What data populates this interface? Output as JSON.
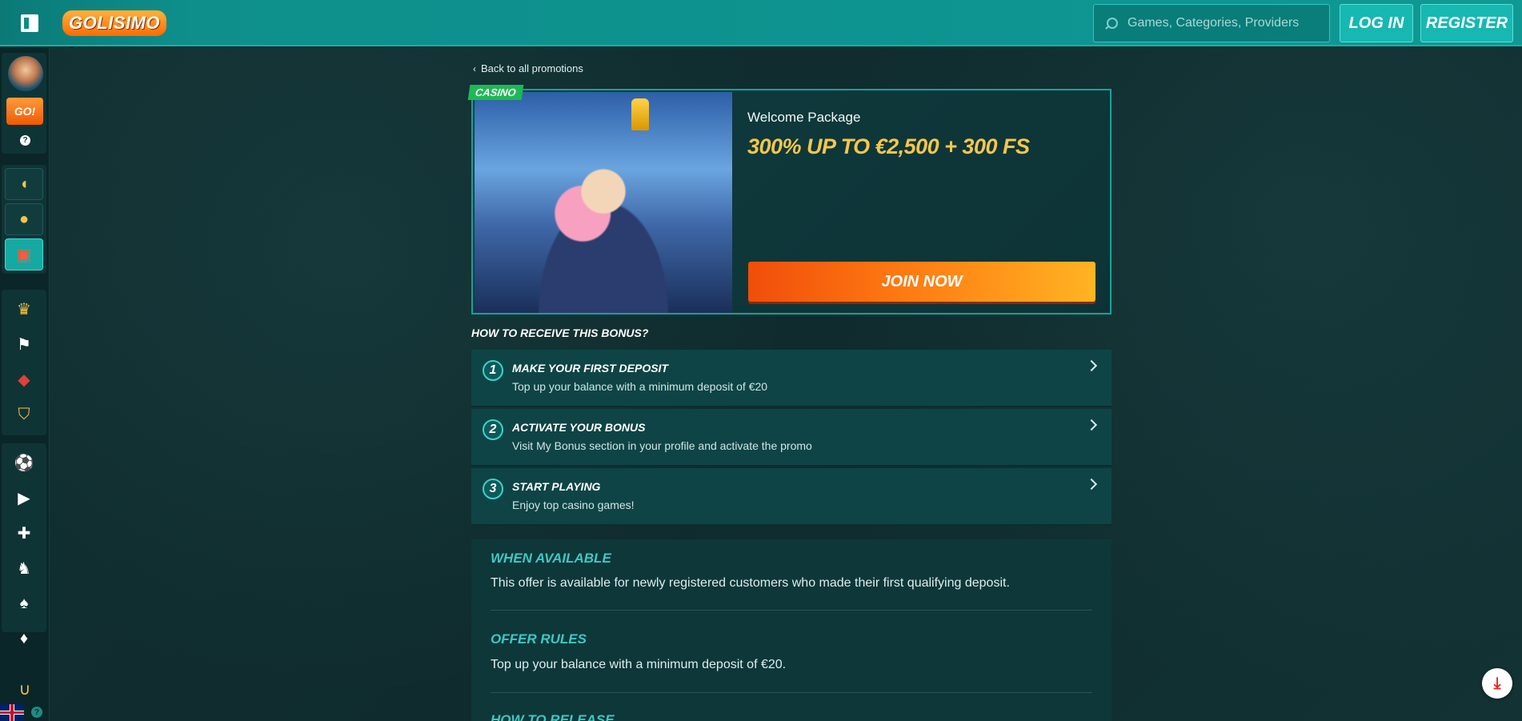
{
  "header": {
    "logo_text": "GOLISIMO",
    "search_placeholder": "Games, Categories, Providers",
    "login_label": "LOG IN",
    "register_label": "REGISTER"
  },
  "sidebar": {
    "go_label": "GO!",
    "help_glyph": "?",
    "items": [
      {
        "icon": "pacman-icon"
      },
      {
        "icon": "medal-icon"
      },
      {
        "icon": "gift-icon",
        "active": true
      },
      {
        "icon": "trophy-icon"
      },
      {
        "icon": "race-flag-icon"
      },
      {
        "icon": "bag-icon"
      },
      {
        "icon": "vip-shield-icon"
      },
      {
        "icon": "soccer-ball-icon"
      },
      {
        "icon": "video-icon"
      },
      {
        "icon": "gamepad-icon"
      },
      {
        "icon": "horse-icon"
      },
      {
        "icon": "cards-icon"
      },
      {
        "icon": "playing-card-icon"
      },
      {
        "icon": "horseshoe-icon"
      }
    ],
    "footer_help": "?"
  },
  "promo": {
    "back_link": "Back to all promotions",
    "tag": "CASINO",
    "name": "Welcome Package",
    "offer": "300% UP TO €2,500 + 300 FS",
    "cta": "JOIN NOW"
  },
  "how": {
    "title": "HOW TO RECEIVE THIS BONUS?",
    "steps": [
      {
        "num": "1",
        "title": "MAKE YOUR FIRST DEPOSIT",
        "desc": "Top up your balance with a minimum deposit of €20"
      },
      {
        "num": "2",
        "title": "ACTIVATE YOUR BONUS",
        "desc": "Visit My Bonus section in your profile and activate the promo"
      },
      {
        "num": "3",
        "title": "START PLAYING",
        "desc": "Enjoy top casino games!"
      }
    ]
  },
  "info": {
    "when_title": "WHEN AVAILABLE",
    "when_text": "This offer is available for newly registered customers who made their first qualifying deposit.",
    "rules_title": "OFFER RULES",
    "rules_text": "Top up your balance with a minimum deposit of €20.",
    "release_title": "HOW TO RELEASE"
  },
  "colors": {
    "header_bg": "#0e8f8c",
    "accent": "#15b1ab",
    "offer_text": "#f7c64a",
    "cta_start": "#f04e0a",
    "cta_end": "#ffb423"
  }
}
